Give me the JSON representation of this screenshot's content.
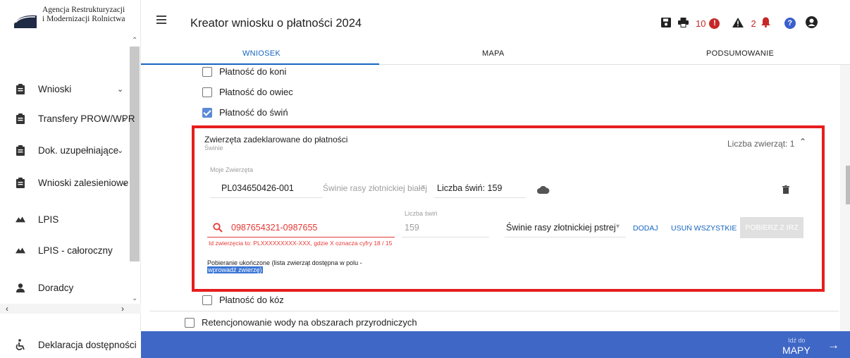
{
  "sidebar": {
    "logo_line1": "Agencja Restrukturyzacji",
    "logo_line2": "i Modernizacji Rolnictwa",
    "items": [
      {
        "label": "Wnioski",
        "icon": "clipboard-icon",
        "chevron": "⌄"
      },
      {
        "label": "Transfery PROW/WPR",
        "icon": "clipboard-icon",
        "chevron": "⌄"
      },
      {
        "label": "Dok. uzupełniające",
        "icon": "clipboard-icon",
        "chevron": "⌄"
      },
      {
        "label": "Wnioski zalesieniowe",
        "icon": "clipboard-icon",
        "chevron": "⌄"
      },
      {
        "label": "LPIS",
        "icon": "mountain-icon"
      },
      {
        "label": "LPIS - całoroczny",
        "icon": "mountain-icon"
      },
      {
        "label": "Doradcy",
        "icon": "person-icon"
      }
    ],
    "declaration": "Deklaracja dostępności"
  },
  "header": {
    "title": "Kreator wniosku o płatności 2024",
    "error_count": "10",
    "warning_count": "2"
  },
  "tabs": [
    "WNIOSEK",
    "MAPA",
    "PODSUMOWANIE"
  ],
  "checkboxes": {
    "konie": "Płatność do koni",
    "owce": "Płatność do owiec",
    "swinie": "Płatność do świń",
    "kozy": "Płatność do kóz",
    "retencja": "Retencjonowanie wody na obszarach przyrodniczych"
  },
  "panel": {
    "title": "Zwierzęta zadeklarowane do płatności",
    "subtitle": "Świnie",
    "count_label": "Liczba zwierząt: 1",
    "my_animals_label": "Moje Zwierzęta",
    "animal_id": "PL034650426-001",
    "breed_existing": "Świnie rasy złotnickiej białej",
    "pigs_count": "Liczba świń: 159",
    "search_value": "0987654321-0987655",
    "count_field_label": "Liczba świń",
    "count_field_value": "159",
    "breed_select": "Świnie rasy złotnickiej pstrej",
    "add": "DODAJ",
    "remove_all": "USUŃ WSZYSTKIE",
    "fetch": "POBIERZ Z IRZ",
    "error_hint": "Id zwierzęcia to: PLXXXXXXXXX-XXX, gdzie X oznacza cyfry 18 / 15",
    "status_line1": "Pobieranie ukończone (lista zwierząt dostępna w polu -",
    "status_line2": "wprowadź zwierzę)"
  },
  "footer": {
    "goto_small": "Idź do",
    "goto_big": "MAPY"
  },
  "colors": {
    "accent": "#1565c0",
    "footer_blue": "#3f67c5",
    "error_red": "#e53935",
    "highlight_red": "#e61e1e"
  }
}
